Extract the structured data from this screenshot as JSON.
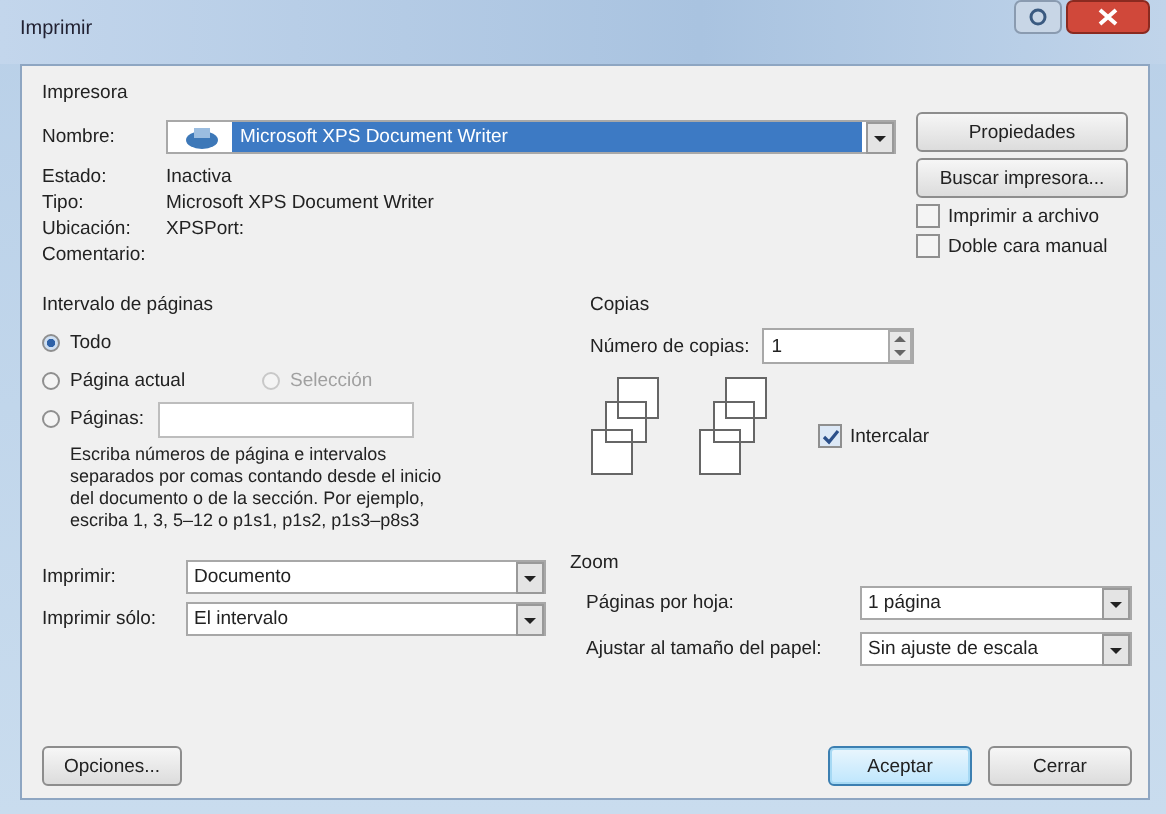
{
  "window": {
    "title": "Imprimir"
  },
  "printer": {
    "heading": "Impresora",
    "name_label": "Nombre:",
    "name_value": "Microsoft XPS Document Writer",
    "info": [
      {
        "label": "Estado:",
        "value": "Inactiva"
      },
      {
        "label": "Tipo:",
        "value": "Microsoft XPS Document Writer"
      },
      {
        "label": "Ubicación:",
        "value": "XPSPort:"
      },
      {
        "label": "Comentario:"
      }
    ],
    "buttons": [
      "Propiedades",
      "Buscar impresora..."
    ],
    "options": [
      {
        "label": "Imprimir a archivo",
        "checked": false
      },
      {
        "label": "Doble cara manual",
        "checked": false
      }
    ]
  },
  "page_range": {
    "heading": "Intervalo de páginas",
    "options": [
      {
        "label": "Todo",
        "selected": true,
        "disabled": false
      },
      {
        "label": "Página actual",
        "selected": false,
        "disabled": false
      },
      {
        "label": "Selección",
        "selected": false,
        "disabled": true
      },
      {
        "label": "Páginas:",
        "selected": false,
        "disabled": false
      }
    ],
    "hint": "Escriba números de página e intervalos separados por comas contando desde el inicio del documento o de la sección. Por ejemplo, escriba 1, 3, 5–12 o p1s1, p1s2, p1s3–p8s3"
  },
  "copies": {
    "heading": "Copias",
    "label": "Número de copias:",
    "value": "1",
    "collate": {
      "label": "Intercalar",
      "checked": true
    }
  },
  "print_what": [
    {
      "label": "Imprimir:",
      "value": "Documento"
    },
    {
      "label": "Imprimir sólo:",
      "value": "El intervalo"
    }
  ],
  "zoom": {
    "heading": "Zoom",
    "rows": [
      {
        "label": "Páginas por hoja:",
        "value": "1 página"
      },
      {
        "label": "Ajustar al tamaño del papel:",
        "value": "Sin ajuste de escala"
      }
    ]
  },
  "footer": {
    "options_button": "Opciones...",
    "ok_button": "Aceptar",
    "cancel_button": "Cerrar"
  }
}
